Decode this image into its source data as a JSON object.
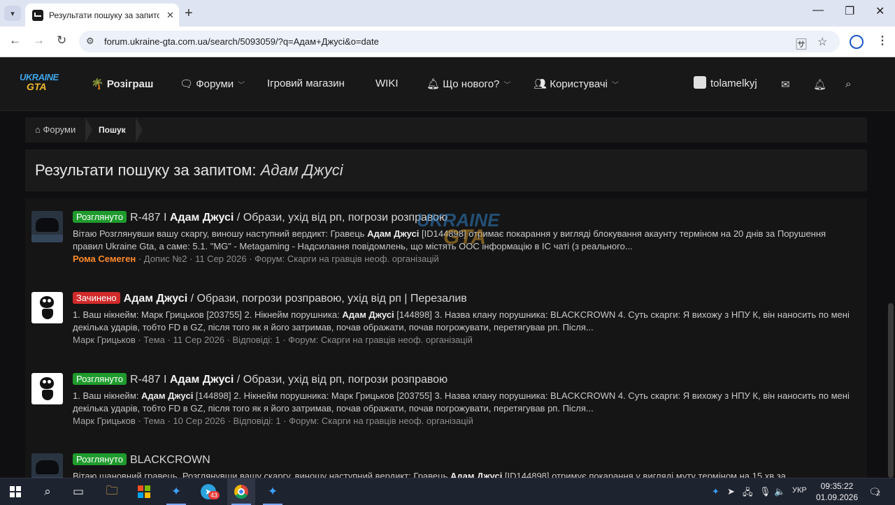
{
  "browser": {
    "tab_title": "Результати пошуку за запитом",
    "tab_close": "✕",
    "new_tab": "+",
    "url": "forum.ukraine-gta.com.ua/search/5093059/?q=Адам+Джусі&o=date"
  },
  "site": {
    "logo_top": "UKRAINE",
    "logo_bottom": "GTA",
    "nav": {
      "giveaway": "Розіграш",
      "forums": "Форуми",
      "shop": "Ігровий магазин",
      "wiki": "WIKI",
      "whats_new": "Що нового?",
      "users": "Користувачі",
      "username": "tolamelkyj"
    },
    "breadcrumb": {
      "home": "Форуми",
      "current": "Пошук"
    },
    "page_title_prefix": "Результати пошуку за запитом:",
    "page_title_query": "Адам Джусі",
    "watermark_top": "UKRAINE",
    "watermark_bottom": "GTA"
  },
  "results": [
    {
      "badge": "Розглянуто",
      "title_pre": "R-487 I ",
      "title_bold": "Адам Джусі",
      "title_post": " / Образи, ухід від рп, погрози розправою",
      "snippet_a": "Вітаю Розглянувши вашу скаргу, виношу наступний вердикт: Гравець ",
      "snippet_bold": "Адам Джусі",
      "snippet_b": " [ID144898] отримає покарання у вигляді блокування акаунту терміном на 20 днів за Порушення правил Ukraine Gta, а саме: 5.1. \"MG\" - Metagaming - Надсилання повідомлень, що містять OOC інформацію в IC чаті (з реального...",
      "author": "Рома Семеген",
      "meta": " · Допис №2 · 11 Сер 2026 · Форум: Скарги на гравців неоф. організацій"
    },
    {
      "badge": "Зачинено",
      "title_pre": "",
      "title_bold": "Адам Джусі",
      "title_post": " / Образи, погрози розправою, ухід від рп | Перезалив",
      "snippet_a": "1. Ваш нікнейм: Марк Грицьков [203755] 2. Нікнейм порушника: ",
      "snippet_bold": "Адам Джусі",
      "snippet_b": " [144898] 3. Назва клану порушника: BLACKCROWN 4. Суть скарги: Я вихожу з НПУ К, він наносить по мені декілька ударів, тобто FD в GZ, після того як я його затримав, почав ображати, почав погрожувати, перетягував рп. Після...",
      "author": "Марк Грицьков",
      "meta": " · Тема · 11 Сер 2026 · Відповіді: 1 · Форум: Скарги на гравців неоф. організацій"
    },
    {
      "badge": "Розглянуто",
      "title_pre": "R-487 I ",
      "title_bold": "Адам Джусі",
      "title_post": " / Образи, ухід від рп, погрози розправою",
      "snippet_a": "1. Ваш нікнейм: ",
      "snippet_bold": "Адам Джусі",
      "snippet_b": " [144898] 2. Нікнейм порушника: Марк Грицьков [203755] 3. Назва клану порушника: BLACKCROWN 4. Суть скарги: Я вихожу з НПУ К, він наносить по мені декілька ударів, тобто FD в GZ, після того як я його затримав, почав ображати, почав погрожувати, перетягував рп. Після...",
      "author": "Марк Грицьков",
      "meta": " · Тема · 10 Сер 2026 · Відповіді: 1 · Форум: Скарги на гравців неоф. організацій"
    },
    {
      "badge": "Розглянуто",
      "title_pre": "BLACKCROWN",
      "title_bold": "",
      "title_post": "",
      "snippet_a": "Вітаю шановний гравець. Розглянувши вашу скаргу, виношу наступний вердикт: Гравець ",
      "snippet_bold": "Адам Джусі",
      "snippet_b": " [ID144898] отримує покарання у вигляді муту терміном на 15 хв за",
      "author": "",
      "meta": ""
    }
  ],
  "taskbar": {
    "telegram_badge": "43",
    "language": "УКР",
    "time": "09:35:22",
    "date": "01.09.2026",
    "notifications": "2"
  },
  "colors": {
    "badge_reviewed": "#1f9b2d",
    "badge_closed": "#d12a2a",
    "author_highlight": "#ff8a2b"
  }
}
